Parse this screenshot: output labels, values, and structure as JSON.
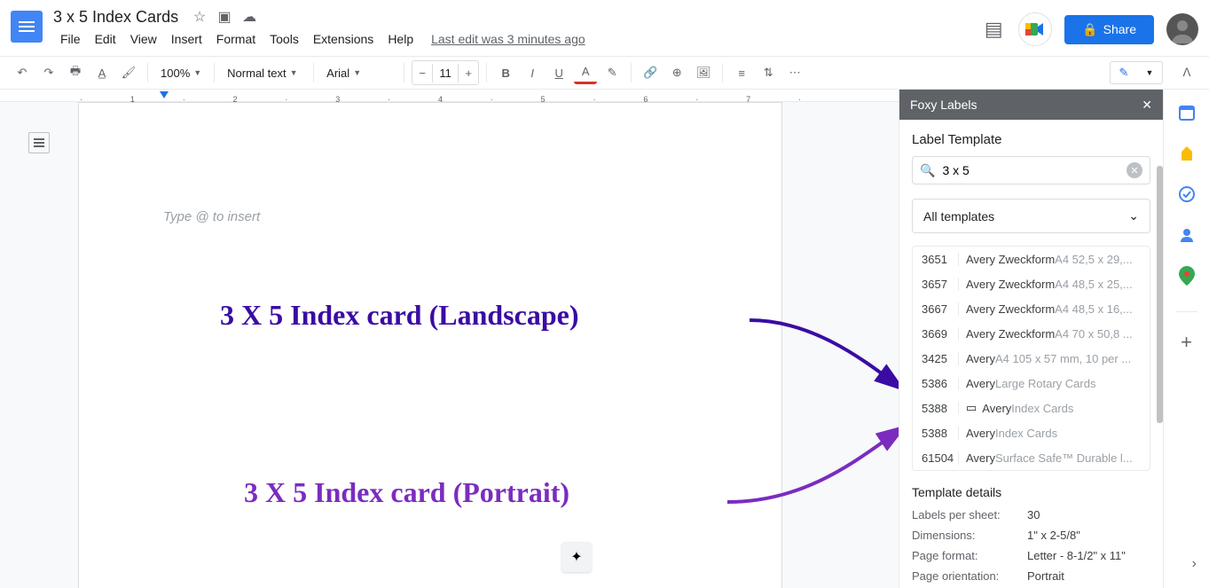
{
  "header": {
    "title": "3 x 5 Index Cards",
    "last_edit": "Last edit was 3 minutes ago",
    "share_label": "Share"
  },
  "menus": [
    "File",
    "Edit",
    "View",
    "Insert",
    "Format",
    "Tools",
    "Extensions",
    "Help"
  ],
  "toolbar": {
    "zoom": "100%",
    "style": "Normal text",
    "font": "Arial",
    "font_size": "11"
  },
  "document": {
    "placeholder": "Type @ to insert"
  },
  "annotations": {
    "landscape": "3 X 5 Index card (Landscape)",
    "portrait": "3 X 5 Index card (Portrait)"
  },
  "panel": {
    "title": "Foxy Labels",
    "section": "Label Template",
    "search_value": "3 x 5",
    "filter": "All templates",
    "results": [
      {
        "code": "3651",
        "brand": "Avery Zweckform",
        "name": " A4 52,5 x 29,..."
      },
      {
        "code": "3657",
        "brand": "Avery Zweckform",
        "name": " A4 48,5 x 25,..."
      },
      {
        "code": "3667",
        "brand": "Avery Zweckform",
        "name": " A4 48,5 x 16,..."
      },
      {
        "code": "3669",
        "brand": "Avery Zweckform",
        "name": " A4 70 x 50,8 ..."
      },
      {
        "code": "3425",
        "brand": "Avery",
        "name": " A4 105 x 57 mm, 10 per ..."
      },
      {
        "code": "5386",
        "brand": "Avery",
        "name": " Large Rotary Cards"
      },
      {
        "code": "5388",
        "brand": "Avery",
        "name": " Index Cards",
        "icon": true
      },
      {
        "code": "5388",
        "brand": "Avery",
        "name": " Index Cards"
      },
      {
        "code": "61504",
        "brand": "Avery",
        "name": " Surface Safe™ Durable l..."
      }
    ],
    "details_title": "Template details",
    "details": [
      {
        "label": "Labels per sheet:",
        "value": "30"
      },
      {
        "label": "Dimensions:",
        "value": "1\" x 2-5/8\""
      },
      {
        "label": "Page format:",
        "value": "Letter - 8-1/2\" x 11\""
      },
      {
        "label": "Page orientation:",
        "value": "Portrait"
      }
    ]
  }
}
